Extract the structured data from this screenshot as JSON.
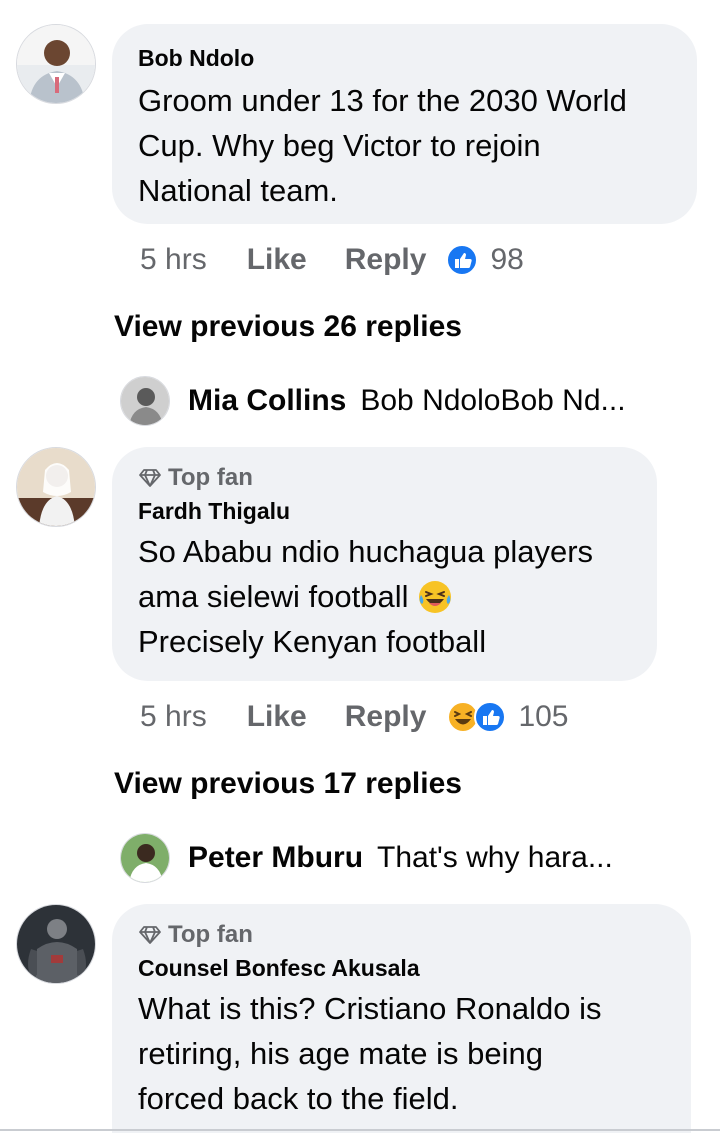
{
  "comments": [
    {
      "author": "Bob Ndolo",
      "top_fan": false,
      "text_lines": [
        "Groom under 13 for the 2030 World",
        "Cup. Why beg Victor to rejoin",
        "National team."
      ],
      "time": "5 hrs",
      "like_label": "Like",
      "reply_label": "Reply",
      "reaction_count": "98",
      "reactions": [
        "like-icon"
      ]
    },
    {
      "author": "Fardh Thigalu",
      "top_fan": true,
      "top_fan_label": "Top fan",
      "text_lines": [
        "So Ababu ndio huchagua players",
        "ama sielewi football",
        "Precisely Kenyan football"
      ],
      "emoji": "laughing-tears-emoji",
      "time": "5 hrs",
      "like_label": "Like",
      "reply_label": "Reply",
      "reaction_count": "105",
      "reactions": [
        "haha-icon",
        "like-icon"
      ]
    },
    {
      "author": "Counsel Bonfesc Akusala",
      "top_fan": true,
      "top_fan_label": "Top fan",
      "text_lines": [
        "What is this? Cristiano Ronaldo is",
        "retiring, his age mate is being",
        "forced back to the field."
      ]
    }
  ],
  "view_previous": [
    "View previous 26 replies",
    "View previous 17 replies"
  ],
  "reply_previews": [
    {
      "name": "Mia Collins",
      "snippet": "Bob NdoloBob Nd..."
    },
    {
      "name": "Peter Mburu",
      "snippet": "That's why hara..."
    }
  ],
  "colors": {
    "bubble": "#f0f2f5",
    "meta_text": "#65676b",
    "like_blue": "#1877f2",
    "haha_yellow": "#f7b125"
  }
}
